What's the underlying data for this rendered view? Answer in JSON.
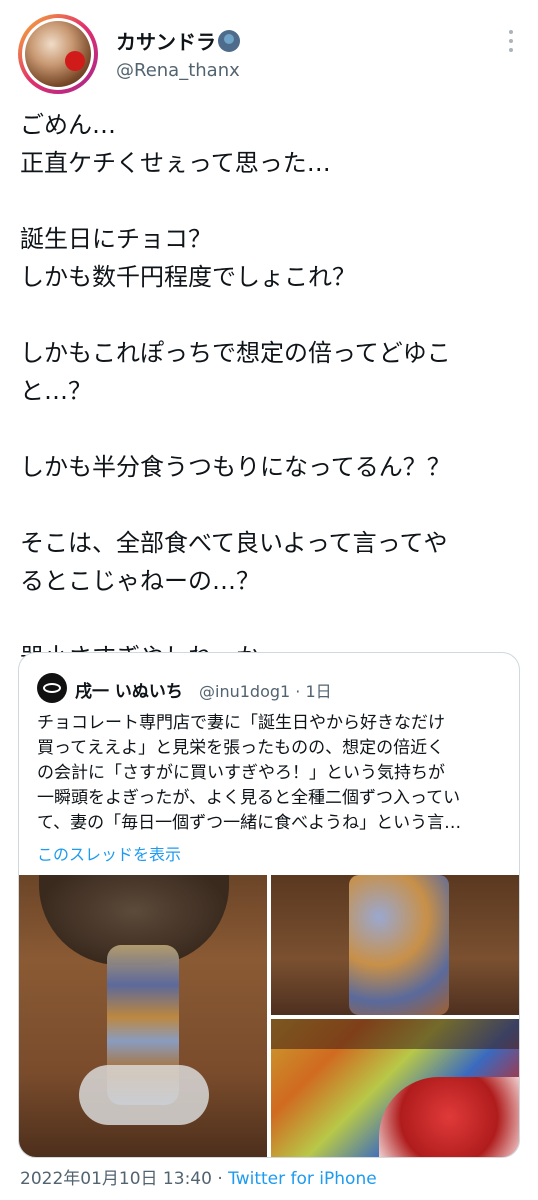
{
  "author": {
    "display_name": "カサンドラ",
    "username": "@Rena_thanx"
  },
  "tweet_lines": [
    "ごめん…",
    "正直ケチくせぇって思った…",
    "",
    "誕生日にチョコ？",
    "しかも数千円程度でしょこれ？",
    "",
    "しかもこれぽっちで想定の倍ってどゆこ",
    "と…？",
    "",
    "しかも半分食うつもりになってるん？？",
    "",
    "そこは、全部食べて良いよって言ってや",
    "るとこじゃねーの…？",
    "",
    "器小さすぎやしねーか…"
  ],
  "quoted": {
    "display_name": "戌一 いぬいち",
    "meta": "@inu1dog1 · 1日",
    "lines": [
      "チョコレート専門店で妻に「誕生日やから好きなだけ",
      "買ってええよ」と見栄を張ったものの、想定の倍近く",
      "の会計に「さすがに買いすぎやろ！」という気持ちが",
      "一瞬頭をよぎったが、よく見ると全種二個ずつ入ってい",
      "て、妻の「毎日一個ずつ一緒に食べようね」という言…"
    ],
    "thread_link": "このスレッドを表示"
  },
  "footer": {
    "timestamp": "2022年01月10日 13:40 · ",
    "source": "Twitter for iPhone"
  },
  "colors": {
    "text": "#0f1419",
    "secondary": "#536471",
    "link": "#1d9bf0",
    "border": "#cfd9de"
  }
}
